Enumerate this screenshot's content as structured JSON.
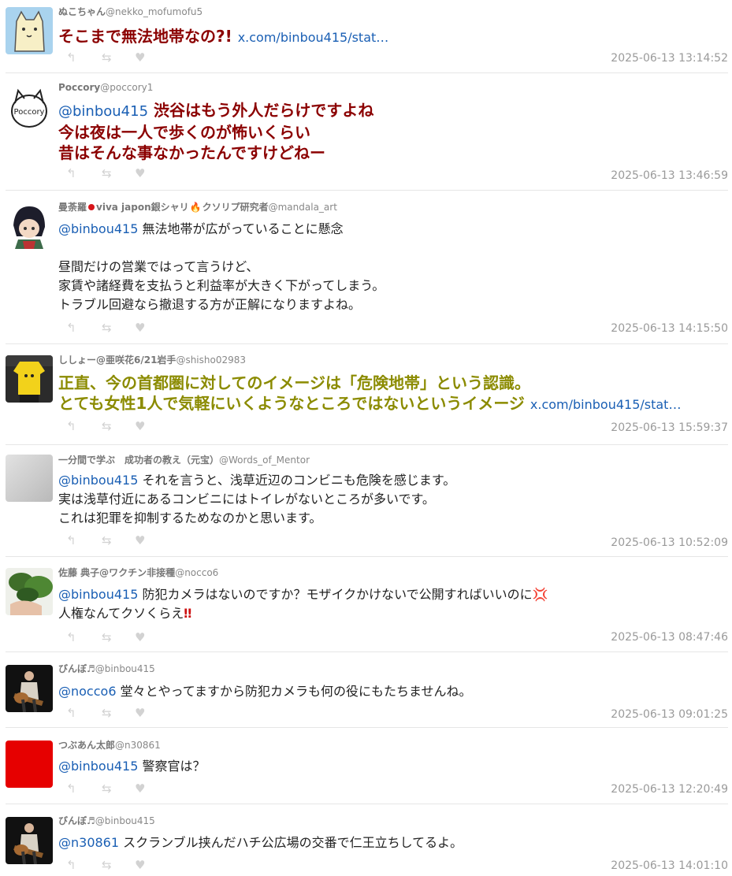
{
  "tweets": [
    {
      "name": "ぬこちゃん",
      "handle": "@nekko_mofumofu5",
      "lines": [
        {
          "text": "そこまで無法地帯なの?!",
          "link": "x.com/binbou415/stat…"
        }
      ],
      "time": "2025-06-13 13:14:52"
    },
    {
      "name": "Poccory",
      "handle": "@poccory1",
      "lines": [
        {
          "mention": "@binbou415",
          "text": "渋谷はもう外人だらけですよね"
        },
        {
          "text": "今は夜は一人で歩くのが怖いくらい"
        },
        {
          "text": "昔はそんな事なかったんですけどねー"
        }
      ],
      "time": "2025-06-13 13:46:59"
    },
    {
      "name_a": "曼荼羅",
      "name_b": "viva japon銀シャリ",
      "name_c": "クソリプ研究者",
      "handle": "@mandala_art",
      "lines": [
        {
          "mention": "@binbou415",
          "text": "無法地帯が広がっていることに懸念"
        },
        {
          "text": ""
        },
        {
          "text": "昼間だけの営業ではって言うけど、"
        },
        {
          "text": "家賃や諸経費を支払うと利益率が大きく下がってしまう。"
        },
        {
          "text": "トラブル回避なら撤退する方が正解になりますよね。"
        }
      ],
      "time": "2025-06-13 14:15:50"
    },
    {
      "name": "ししょー@亜咲花6/21岩手",
      "handle": "@shisho02983",
      "lines": [
        {
          "text": "正直、今の首都圏に対してのイメージは「危険地帯」という認識。"
        },
        {
          "text": "とても女性1人で気軽にいくようなところではないというイメージ",
          "link": "x.com/binbou415/stat…"
        }
      ],
      "time": "2025-06-13 15:59:37"
    },
    {
      "name": "一分間で学ぶ　成功者の教え（元宝）",
      "handle": "@Words_of_Mentor",
      "lines": [
        {
          "mention": "@binbou415",
          "text": "それを言うと、浅草近辺のコンビニも危険を感じます。"
        },
        {
          "text": "実は浅草付近にあるコンビニにはトイレがないところが多いです。"
        },
        {
          "text": "これは犯罪を抑制するためなのかと思います。"
        }
      ],
      "time": "2025-06-13 10:52:09"
    },
    {
      "name": "佐藤 典子@ワクチン非接種",
      "handle": "@nocco6",
      "lines": [
        {
          "mention": "@binbou415",
          "text": "防犯カメラはないのですか？モザイクかけないで公開すればいいのに",
          "emoji": "💢"
        },
        {
          "text": "人権なんてクソくらえ",
          "emoji": "‼"
        }
      ],
      "time": "2025-06-13 08:47:46"
    },
    {
      "name": "びんぼ♬",
      "handle": "@binbou415",
      "lines": [
        {
          "mention": "@nocco6",
          "text": "堂々とやってますから防犯カメラも何の役にもたちませんね。"
        }
      ],
      "time": "2025-06-13 09:01:25"
    },
    {
      "name": "つぶあん太郎",
      "handle": "@n30861",
      "lines": [
        {
          "mention": "@binbou415",
          "text": "警察官は？"
        }
      ],
      "time": "2025-06-13 12:20:49"
    },
    {
      "name": "びんぼ♬",
      "handle": "@binbou415",
      "lines": [
        {
          "mention": "@n30861",
          "text": "スクランブル挟んだハチ公広場の交番で仁王立ちしてるよ。"
        }
      ],
      "time": "2025-06-13 14:01:10"
    }
  ],
  "icons": {
    "reply": "reply-arrow-icon",
    "retweet": "retweet-icon",
    "like": "heart-icon"
  },
  "colors": {
    "red_text": "#8b0000",
    "olive_text": "#8b8b00",
    "link": "#1a5fb4",
    "timestamp": "#9a9a9a"
  }
}
